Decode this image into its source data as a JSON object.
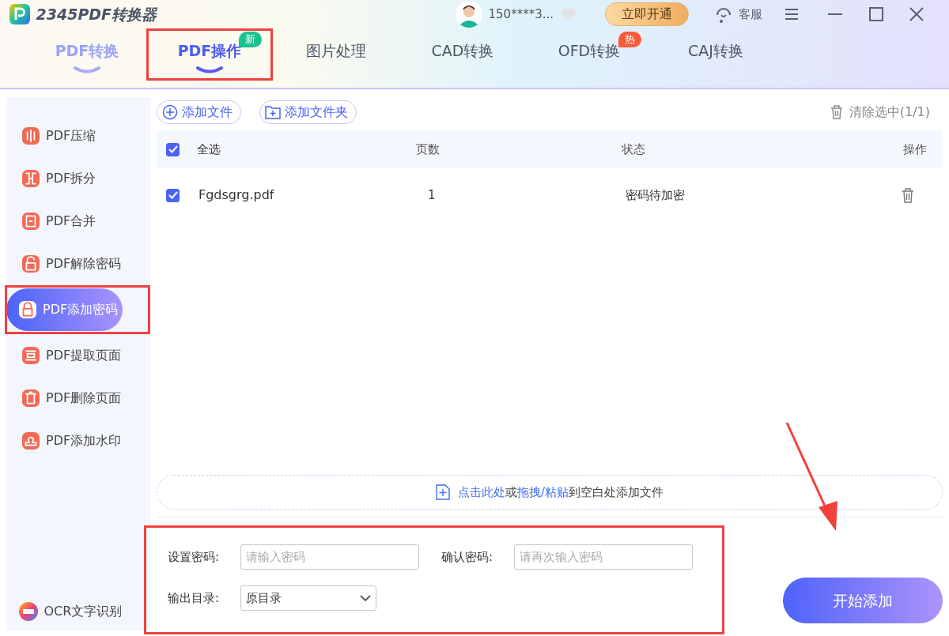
{
  "app": {
    "title": "2345PDF转换器"
  },
  "user": {
    "name": "150****3...",
    "vip_button": "立即开通",
    "service": "客服"
  },
  "tabs": [
    {
      "label": "PDF转换",
      "selected": false,
      "highlighted": false
    },
    {
      "label": "PDF操作",
      "selected": true,
      "badge": {
        "text": "新",
        "color": "#19c38e"
      },
      "highlighted": true
    },
    {
      "label": "图片处理",
      "selected": false,
      "highlighted": false
    },
    {
      "label": "CAD转换",
      "selected": false,
      "highlighted": false
    },
    {
      "label": "OFD转换",
      "selected": false,
      "badge": {
        "text": "热",
        "color": "#fa5a3c"
      },
      "highlighted": false
    },
    {
      "label": "CAJ转换",
      "selected": false,
      "highlighted": false
    }
  ],
  "sidebar": {
    "items": [
      {
        "label": "PDF压缩",
        "selected": false,
        "highlighted": false
      },
      {
        "label": "PDF拆分",
        "selected": false,
        "highlighted": false
      },
      {
        "label": "PDF合并",
        "selected": false,
        "highlighted": false
      },
      {
        "label": "PDF解除密码",
        "selected": false,
        "highlighted": false
      },
      {
        "label": "PDF添加密码",
        "selected": true,
        "highlighted": true
      },
      {
        "label": "PDF提取页面",
        "selected": false,
        "highlighted": false
      },
      {
        "label": "PDF删除页面",
        "selected": false,
        "highlighted": false
      },
      {
        "label": "PDF添加水印",
        "selected": false,
        "highlighted": false
      }
    ],
    "footer": "OCR文字识别"
  },
  "toolbar": {
    "add_file": "添加文件",
    "add_folder": "添加文件夹",
    "clear": "清除选中(1/1)"
  },
  "table": {
    "select_all": {
      "label": "全选",
      "checked": true
    },
    "columns": [
      "页数",
      "状态",
      "操作"
    ],
    "rows": [
      {
        "name": "Fgdsgrg.pdf",
        "checked": true,
        "pages": "1",
        "status": "密码待加密"
      }
    ]
  },
  "drop_zone": {
    "parts": [
      {
        "text": "点击此处",
        "link": true
      },
      {
        "text": "或",
        "link": false
      },
      {
        "text": "拖拽/粘贴",
        "link": true
      },
      {
        "text": "到空白处添加文件",
        "link": false
      }
    ]
  },
  "settings": {
    "highlighted": true,
    "password_label": "设置密码:",
    "password_placeholder": "请输入密码",
    "confirm_label": "确认密码:",
    "confirm_placeholder": "请再次输入密码",
    "output_label": "输出目录:",
    "output_value": "原目录"
  },
  "start_button": {
    "label": "开始添加",
    "arrow_pointer": true
  }
}
